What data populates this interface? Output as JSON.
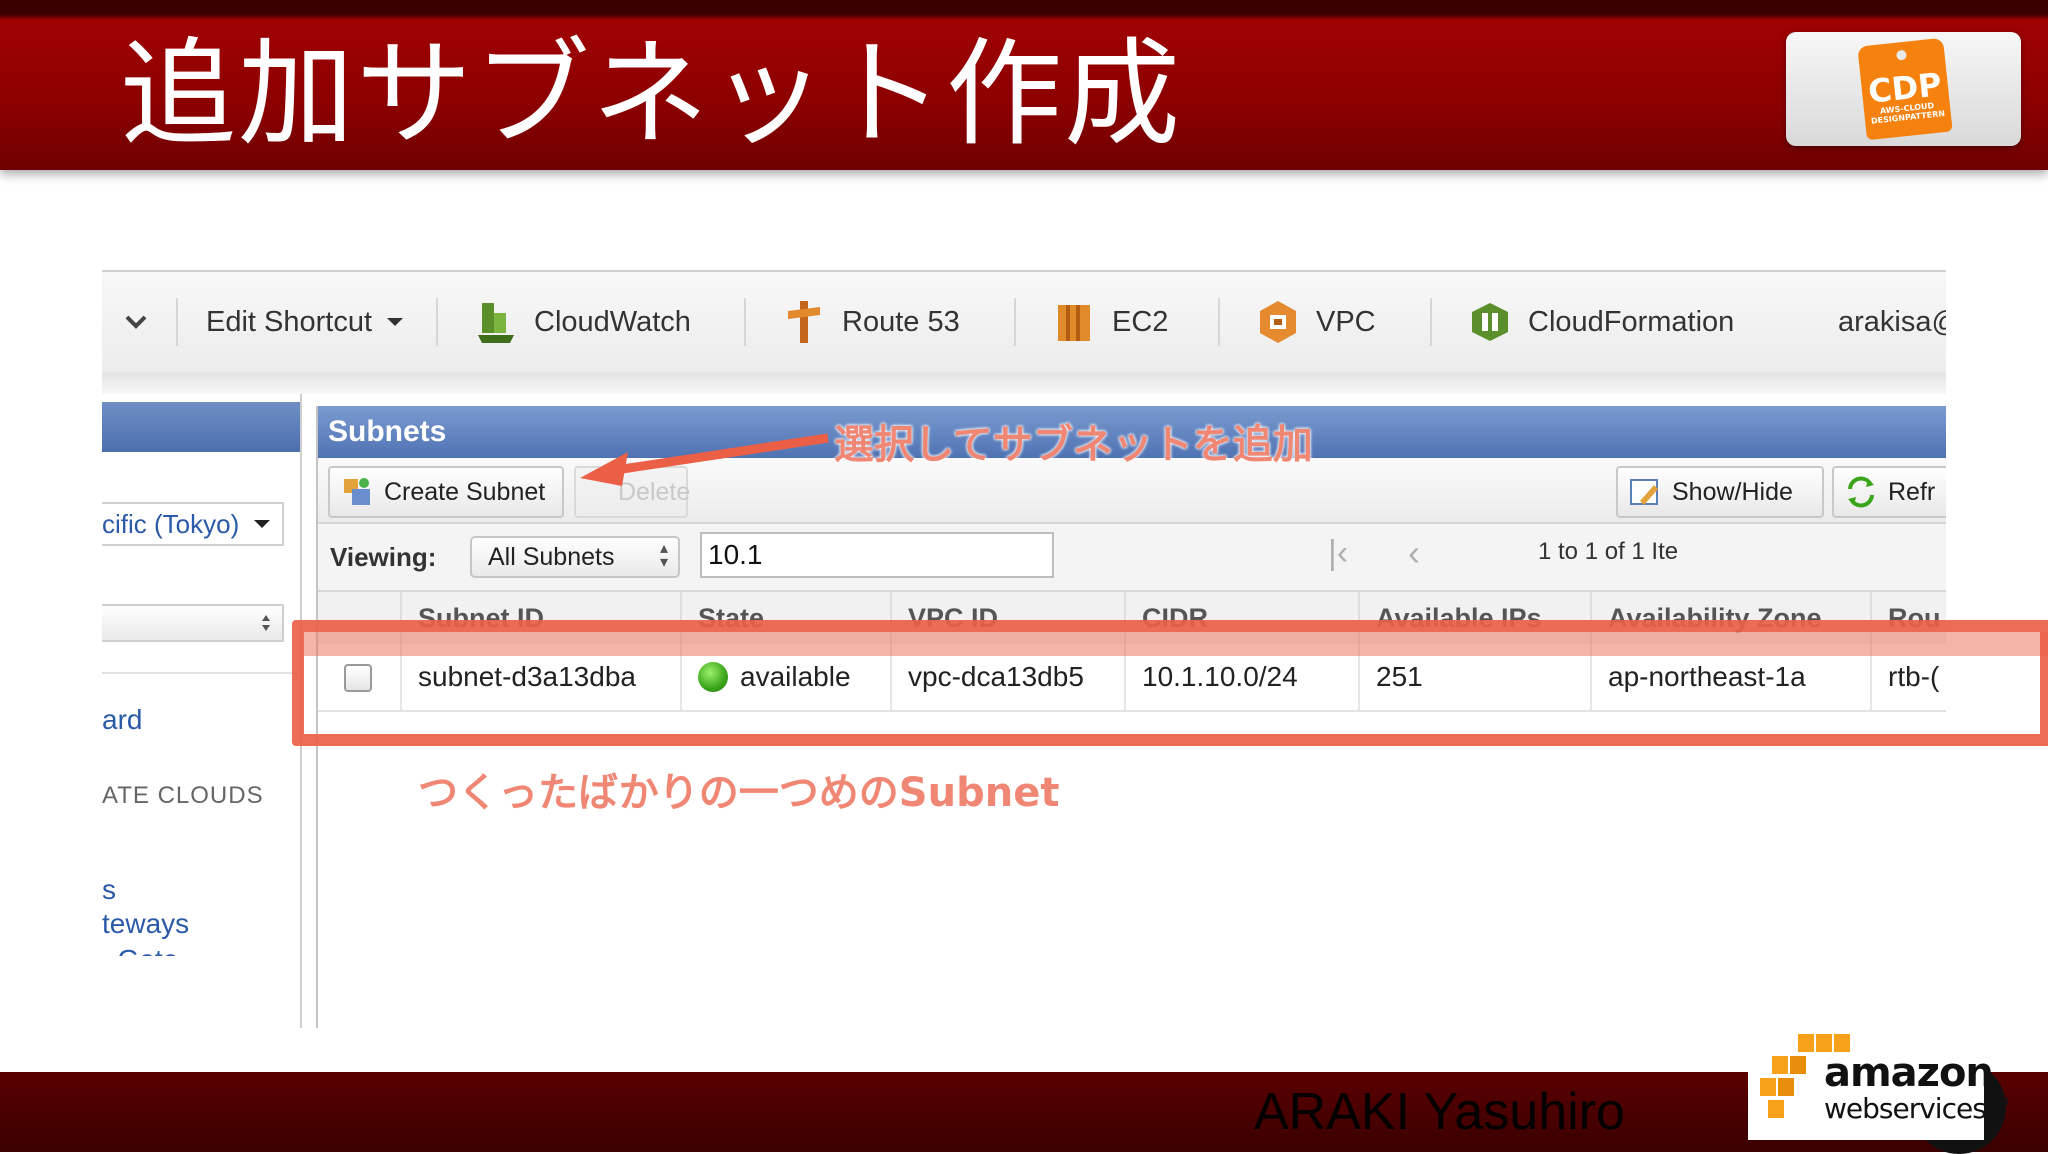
{
  "slide": {
    "title": "追加サブネット作成",
    "author": "ARAKI Yasuhiro",
    "logo_text": "CDP",
    "logo_subtext": "AWS-CLOUD DESIGNPATTERN"
  },
  "topnav": {
    "edit_shortcut": "Edit Shortcut",
    "services": [
      "CloudWatch",
      "Route 53",
      "EC2",
      "VPC",
      "CloudFormation"
    ],
    "user": "arakisa@"
  },
  "sidebar": {
    "region": "cific (Tokyo)",
    "wizard_link": "ard",
    "section_heading": "ATE CLOUDS",
    "link_partial_1": "s",
    "link_partial_2": "teways",
    "link_partial_3": "..Gate"
  },
  "panel": {
    "title": "Subnets",
    "create_button": "Create Subnet",
    "delete_button": "Delete",
    "showhide_button": "Show/Hide",
    "refresh_button": "Refr",
    "viewing_label": "Viewing:",
    "viewing_select": "All Subnets",
    "filter_value": "10.1",
    "pagination": "1 to 1 of 1 Ite"
  },
  "table": {
    "columns": [
      "Subnet ID",
      "State",
      "VPC ID",
      "CIDR",
      "Available IPs",
      "Availability Zone",
      "Rou"
    ],
    "rows": [
      {
        "subnet_id": "subnet-d3a13dba",
        "state": "available",
        "vpc_id": "vpc-dca13db5",
        "cidr": "10.1.10.0/24",
        "available_ips": "251",
        "az": "ap-northeast-1a",
        "route": "rtb-("
      }
    ]
  },
  "annotations": {
    "arrow_note": "選択してサブネットを追加",
    "row_note": "つくったばかりの一つめのSubnet"
  },
  "colors": {
    "header_red": "#8a0000",
    "panel_blue": "#5a7cbd",
    "annotation": "#eb5f46",
    "status_green": "#3aa51b"
  }
}
